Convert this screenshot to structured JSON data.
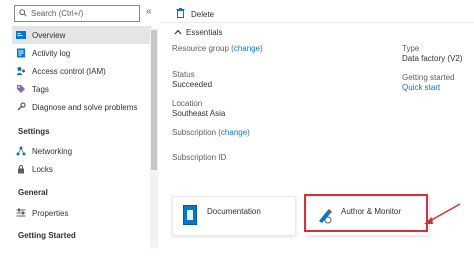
{
  "sidebar": {
    "search_placeholder": "Search (Ctrl+/)",
    "collapse_glyph": "«",
    "items": [
      {
        "label": "Overview",
        "icon": "overview-icon",
        "active": true
      },
      {
        "label": "Activity log",
        "icon": "activity-log-icon"
      },
      {
        "label": "Access control (IAM)",
        "icon": "iam-icon"
      },
      {
        "label": "Tags",
        "icon": "tag-icon"
      },
      {
        "label": "Diagnose and solve problems",
        "icon": "wrench-icon"
      }
    ],
    "settings_heading": "Settings",
    "settings_items": [
      {
        "label": "Networking",
        "icon": "network-icon"
      },
      {
        "label": "Locks",
        "icon": "lock-icon"
      }
    ],
    "general_heading": "General",
    "general_items": [
      {
        "label": "Properties",
        "icon": "properties-icon"
      }
    ],
    "getting_started_heading": "Getting Started"
  },
  "toolbar": {
    "delete_label": "Delete"
  },
  "essentials": {
    "heading": "Essentials",
    "resource_group_label": "Resource group (",
    "resource_group_change": "change",
    "resource_group_close": ")",
    "status_label": "Status",
    "status_value": "Succeeded",
    "location_label": "Location",
    "location_value": "Southeast Asia",
    "subscription_label": "Subscription (",
    "subscription_change": "change",
    "subscription_close": ")",
    "subscription_id_label": "Subscription ID",
    "type_label": "Type",
    "type_value": "Data factory (V2)",
    "getting_started_label": "Getting started",
    "quick_start_link": "Quick start"
  },
  "cards": {
    "documentation_label": "Documentation",
    "author_monitor_label": "Author & Monitor"
  },
  "colors": {
    "accent": "#0078d4",
    "highlight": "#d13438"
  }
}
